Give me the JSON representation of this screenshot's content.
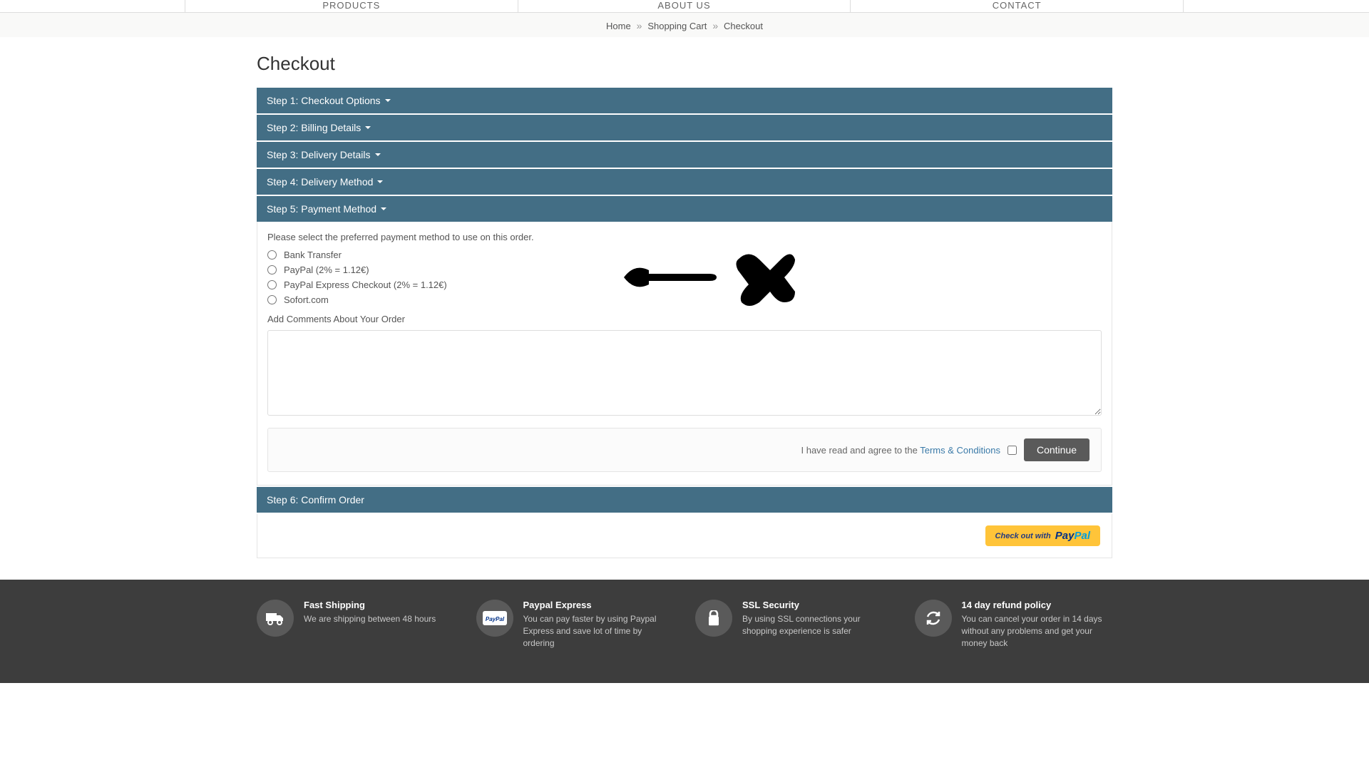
{
  "nav": {
    "products": "PRODUCTS",
    "about": "ABOUT US",
    "contact": "CONTACT"
  },
  "breadcrumb": {
    "home": "Home",
    "cart": "Shopping Cart",
    "checkout": "Checkout"
  },
  "page_title": "Checkout",
  "steps": {
    "s1": "Step 1: Checkout Options",
    "s2": "Step 2: Billing Details",
    "s3": "Step 3: Delivery Details",
    "s4": "Step 4: Delivery Method",
    "s5": "Step 5: Payment Method",
    "s6": "Step 6: Confirm Order"
  },
  "payment": {
    "prompt": "Please select the preferred payment method to use on this order.",
    "options": {
      "bank": "Bank Transfer",
      "paypal": "PayPal (2% = 1.12€)",
      "paypal_express": "PayPal Express Checkout (2% = 1.12€)",
      "sofort": "Sofort.com"
    },
    "add_comments": "Add Comments About Your Order"
  },
  "terms": {
    "pre_text": "I have read and agree to the ",
    "link": "Terms & Conditions",
    "continue": "Continue"
  },
  "paypal_button": "Check out with",
  "features": {
    "ship_title": "Fast Shipping",
    "ship_text": "We are shipping between 48 hours",
    "pp_title": "Paypal Express",
    "pp_text": "You can pay faster by using Paypal Express and save lot of time by ordering",
    "ssl_title": "SSL Security",
    "ssl_text": "By using SSL connections your shopping experience is safer",
    "refund_title": "14 day refund policy",
    "refund_text": "You can cancel your order in 14 days without any problems and get your money back"
  }
}
